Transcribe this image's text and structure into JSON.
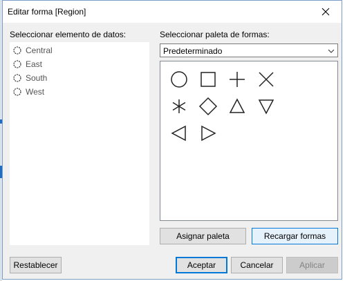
{
  "dialog": {
    "title": "Editar forma [Region]",
    "close_icon": "close-icon"
  },
  "left_panel": {
    "label": "Seleccionar elemento de datos:",
    "items": [
      {
        "label": "Central",
        "icon": "circle-shape-icon"
      },
      {
        "label": "East",
        "icon": "circle-shape-icon"
      },
      {
        "label": "South",
        "icon": "circle-shape-icon"
      },
      {
        "label": "West",
        "icon": "circle-shape-icon"
      }
    ]
  },
  "right_panel": {
    "label": "Seleccionar paleta de formas:",
    "palette_select": {
      "value": "Predeterminado"
    },
    "shapes": [
      "circle",
      "square",
      "plus",
      "times",
      "asterisk",
      "diamond",
      "triangle-up",
      "triangle-down",
      "triangle-left",
      "triangle-right"
    ],
    "assign_button": "Asignar paleta",
    "reload_button": "Recargar formas"
  },
  "footer": {
    "reset_button": "Restablecer",
    "ok_button": "Aceptar",
    "cancel_button": "Cancelar",
    "apply_button": "Aplicar"
  },
  "colors": {
    "accent": "#0078d7",
    "dialog_bg": "#f0f0f0",
    "disabled_text": "#838383"
  }
}
